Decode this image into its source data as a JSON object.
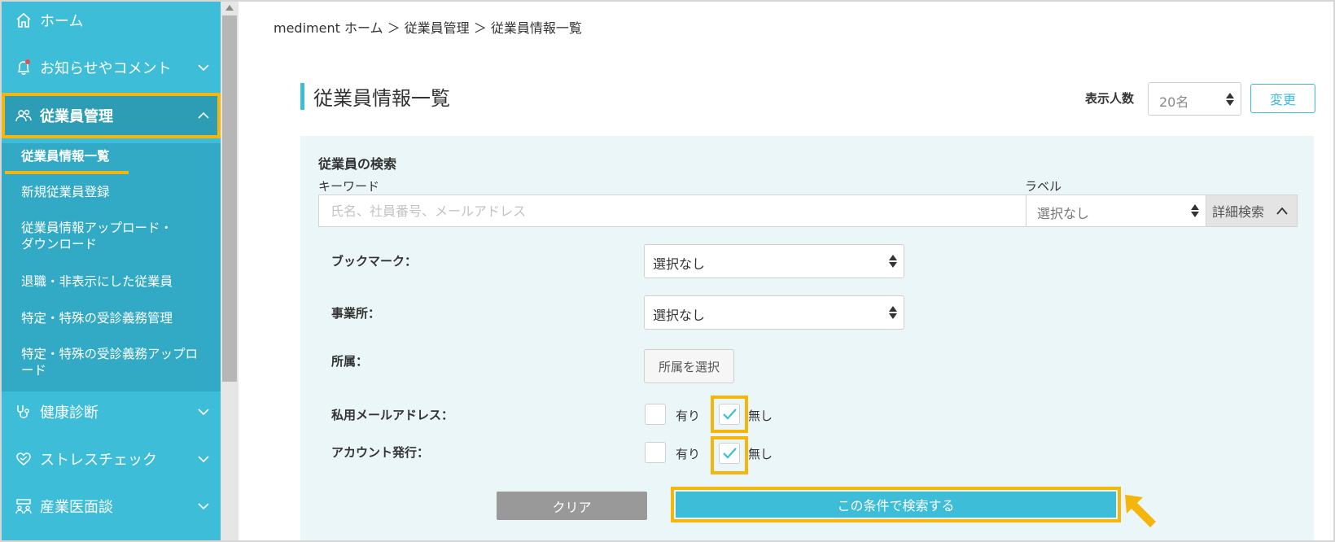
{
  "sidebar": {
    "items": [
      {
        "label": "ホーム",
        "icon": "home-icon"
      },
      {
        "label": "お知らせやコメント",
        "icon": "bell-icon"
      },
      {
        "label": "従業員管理",
        "icon": "people-icon"
      },
      {
        "label": "健康診断",
        "icon": "stethoscope-icon"
      },
      {
        "label": "ストレスチェック",
        "icon": "heart-icon"
      },
      {
        "label": "産業医面談",
        "icon": "meeting-icon"
      }
    ],
    "submenu": [
      "従業員情報一覧",
      "新規従業員登録",
      "従業員情報アップロード・\nダウンロード",
      "退職・非表示にした従業員",
      "特定・特殊の受診義務管理",
      "特定・特殊の受診義務アップロ\nード"
    ]
  },
  "breadcrumb": "mediment ホーム ＞ 従業員管理 ＞ 従業員情報一覧",
  "page_title": "従業員情報一覧",
  "display_count": {
    "label": "表示人数",
    "value": "20名",
    "button": "変更"
  },
  "search": {
    "title": "従業員の検索",
    "keyword_label": "キーワード",
    "keyword_placeholder": "氏名、社員番号、メールアドレス",
    "label_label": "ラベル",
    "label_value": "選択なし",
    "detail_button": "詳細検索",
    "bookmark_label": "ブックマーク：",
    "bookmark_value": "選択なし",
    "office_label": "事業所：",
    "office_value": "選択なし",
    "affiliation_label": "所属：",
    "affiliation_button": "所属を選択",
    "private_email_label": "私用メールアドレス：",
    "account_label": "アカウント発行：",
    "option_yes": "有り",
    "option_no": "無し",
    "clear_button": "クリア",
    "search_button": "この条件で検索する"
  },
  "colors": {
    "accent": "#3ebdd9",
    "highlight": "#f4b50c",
    "sidebar_active": "#2c9db5"
  }
}
